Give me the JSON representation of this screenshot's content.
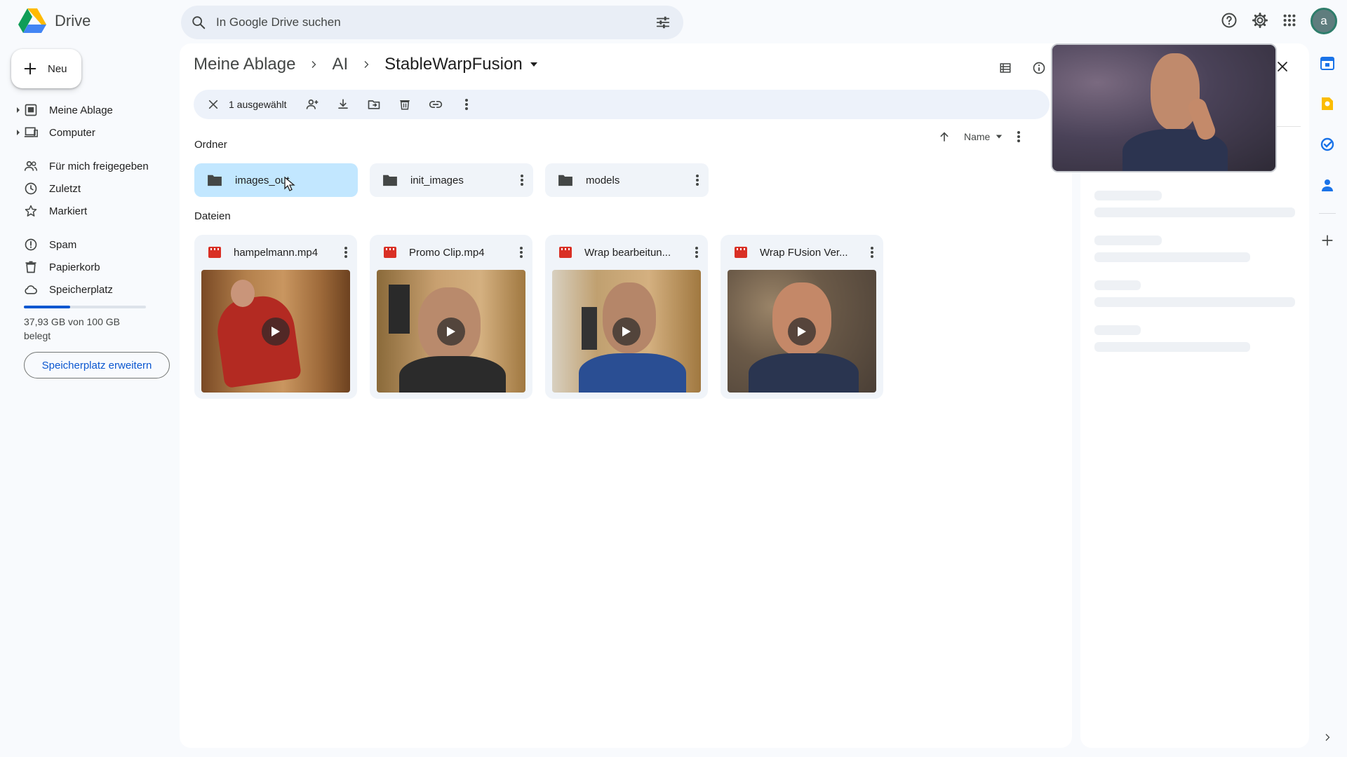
{
  "app": {
    "name": "Drive"
  },
  "search": {
    "placeholder": "In Google Drive suchen"
  },
  "header": {
    "avatar_letter": "a"
  },
  "sidebar": {
    "new_label": "Neu",
    "items": [
      {
        "label": "Meine Ablage",
        "icon": "my-drive-icon"
      },
      {
        "label": "Computer",
        "icon": "computer-icon"
      },
      {
        "label": "Für mich freigegeben",
        "icon": "shared-icon"
      },
      {
        "label": "Zuletzt",
        "icon": "clock-icon"
      },
      {
        "label": "Markiert",
        "icon": "star-icon"
      },
      {
        "label": "Spam",
        "icon": "spam-icon"
      },
      {
        "label": "Papierkorb",
        "icon": "trash-icon"
      },
      {
        "label": "Speicherplatz",
        "icon": "cloud-icon"
      }
    ],
    "storage": {
      "used_fraction": 0.38,
      "text_line1": "37,93 GB von 100 GB",
      "text_line2": "belegt",
      "button_label": "Speicherplatz erweitern"
    }
  },
  "breadcrumb": {
    "items": [
      "Meine Ablage",
      "AI",
      "StableWarpFusion"
    ]
  },
  "selection_bar": {
    "text": "1 ausgewählt"
  },
  "sections": {
    "folders_title": "Ordner",
    "files_title": "Dateien"
  },
  "sort": {
    "label": "Name"
  },
  "folders": [
    {
      "name": "images_out",
      "selected": true
    },
    {
      "name": "init_images",
      "selected": false
    },
    {
      "name": "models",
      "selected": false
    }
  ],
  "files": [
    {
      "name": "hampelmann.mp4"
    },
    {
      "name": "Promo Clip.mp4"
    },
    {
      "name": "Wrap bearbeitun..."
    },
    {
      "name": "Wrap FUsion Ver..."
    }
  ],
  "colors": {
    "accent": "#0b57d0",
    "selected_folder": "#c2e7ff",
    "video_icon": "#d93025"
  }
}
